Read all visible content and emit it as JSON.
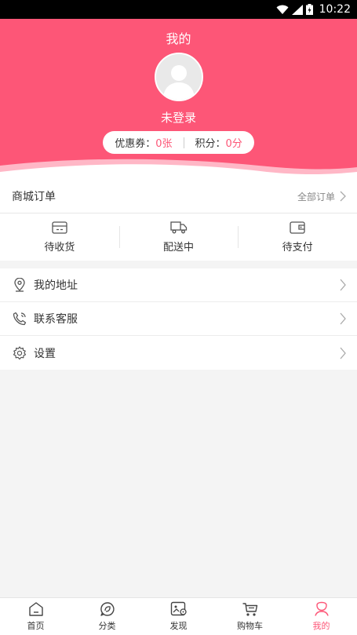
{
  "status_bar": {
    "time": "10:22"
  },
  "header": {
    "title": "我的",
    "login_text": "未登录",
    "coupon_label": "优惠券：",
    "coupon_value": "0张",
    "points_label": "积分：",
    "points_value": "0分",
    "bg_color": "#fd5677"
  },
  "orders": {
    "title": "商城订单",
    "all_label": "全部订单",
    "items": [
      {
        "label": "待收货",
        "icon": "card-icon"
      },
      {
        "label": "配送中",
        "icon": "truck-icon"
      },
      {
        "label": "待支付",
        "icon": "wallet-icon"
      }
    ]
  },
  "menu": [
    {
      "label": "我的地址",
      "icon": "location-icon"
    },
    {
      "label": "联系客服",
      "icon": "phone-icon"
    },
    {
      "label": "设置",
      "icon": "gear-icon"
    }
  ],
  "nav": {
    "items": [
      {
        "label": "首页",
        "icon": "home-icon"
      },
      {
        "label": "分类",
        "icon": "category-icon"
      },
      {
        "label": "发现",
        "icon": "discover-icon"
      },
      {
        "label": "购物车",
        "icon": "cart-icon"
      },
      {
        "label": "我的",
        "icon": "profile-icon",
        "active": true
      }
    ],
    "active_color": "#fd5677"
  }
}
